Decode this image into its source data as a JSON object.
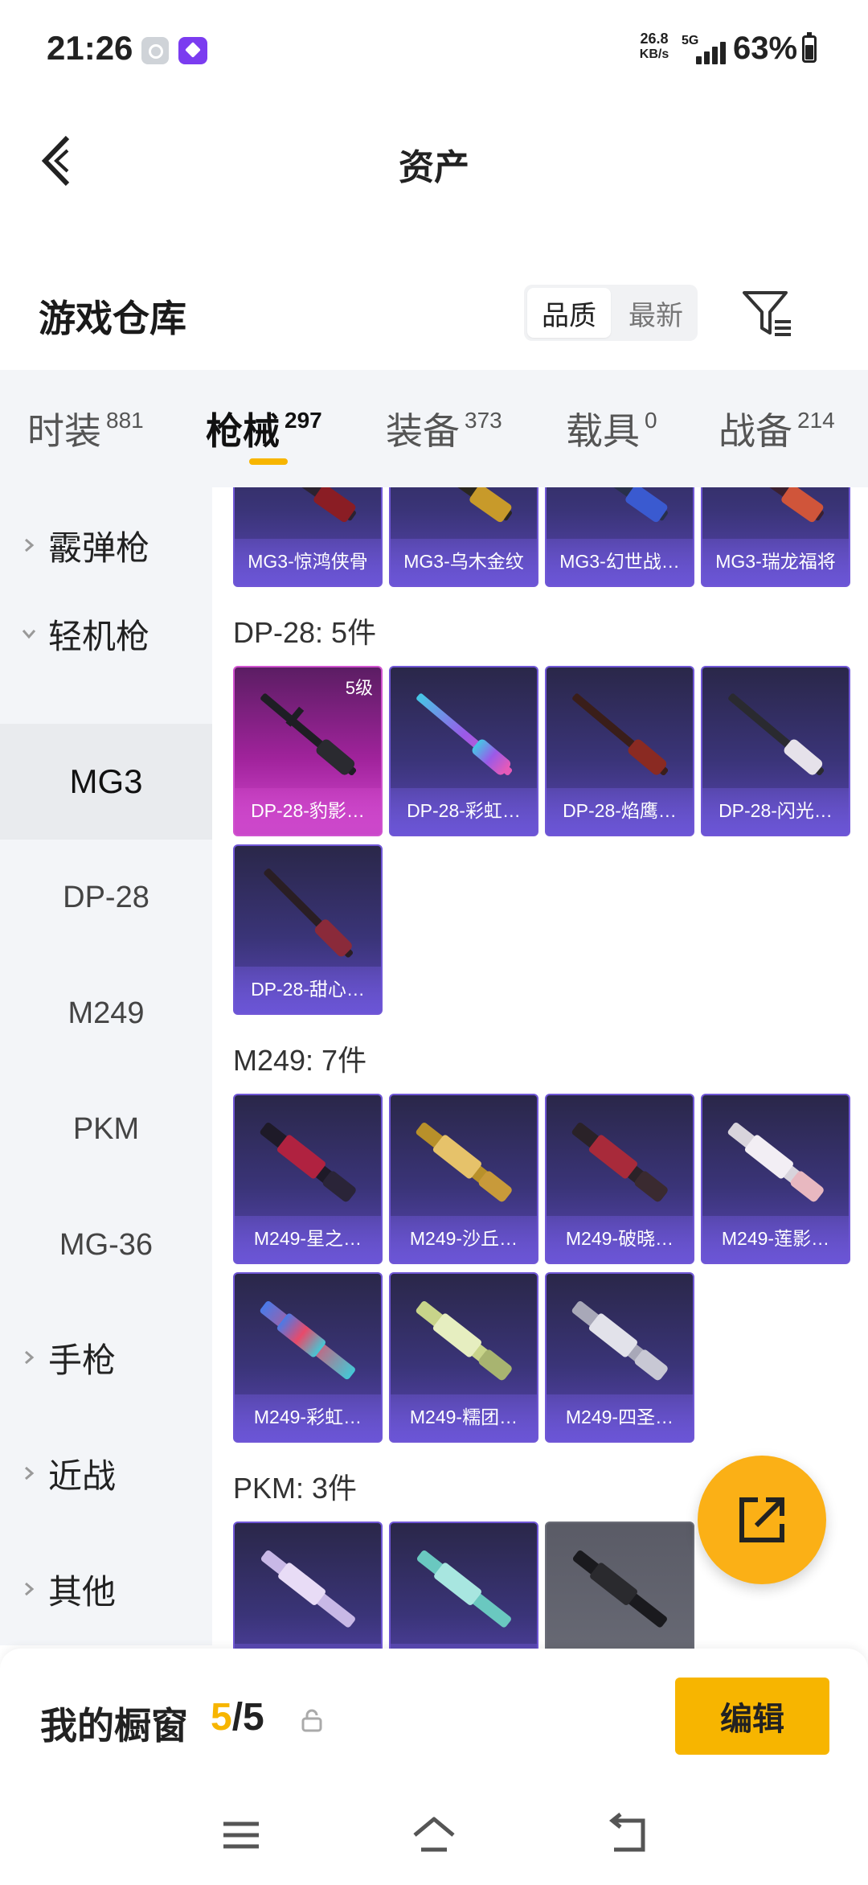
{
  "status_bar": {
    "time": "21:26",
    "net_speed_value": "26.8",
    "net_speed_unit": "KB/s",
    "network_type": "5G",
    "battery_percent": "63%",
    "battery_level": 0.63,
    "status_icons": [
      "settings-app-icon",
      "purple-app-icon"
    ]
  },
  "header": {
    "title": "资产",
    "back_icon": "back-arrow-icon"
  },
  "section": {
    "title": "游戏仓库",
    "sort_options": [
      "品质",
      "最新"
    ],
    "sort_selected": "品质",
    "filter_icon": "filter-icon"
  },
  "tabs": [
    {
      "label": "时装",
      "count": "881"
    },
    {
      "label": "枪械",
      "count": "297",
      "active": true
    },
    {
      "label": "装备",
      "count": "373"
    },
    {
      "label": "载具",
      "count": "0"
    },
    {
      "label": "战备",
      "count": "214"
    }
  ],
  "sidebar": {
    "items": [
      {
        "label": "霰弹枪",
        "type": "group",
        "expanded": false
      },
      {
        "label": "轻机枪",
        "type": "group",
        "expanded": true
      },
      {
        "label": "MG3",
        "type": "sub",
        "selected": true
      },
      {
        "label": "DP-28",
        "type": "sub"
      },
      {
        "label": "M249",
        "type": "sub"
      },
      {
        "label": "PKM",
        "type": "sub"
      },
      {
        "label": "MG-36",
        "type": "sub"
      },
      {
        "label": "手枪",
        "type": "group",
        "expanded": false
      },
      {
        "label": "近战",
        "type": "group",
        "expanded": false
      },
      {
        "label": "其他",
        "type": "group",
        "expanded": false
      }
    ]
  },
  "content": {
    "mg3_items": [
      "MG3-惊鸿侠骨",
      "MG3-乌木金纹",
      "MG3-幻世战…",
      "MG3-瑞龙福将"
    ],
    "dp28_header": "DP-28: 5件",
    "dp28_items": [
      {
        "name": "DP-28-豹影…",
        "level": "5级",
        "style": "pink"
      },
      {
        "name": "DP-28-彩虹…"
      },
      {
        "name": "DP-28-焰鹰…"
      },
      {
        "name": "DP-28-闪光…"
      },
      {
        "name": "DP-28-甜心…"
      }
    ],
    "m249_header": "M249: 7件",
    "m249_items": [
      "M249-星之…",
      "M249-沙丘…",
      "M249-破晓…",
      "M249-莲影…",
      "M249-彩虹…",
      "M249-糯团…",
      "M249-四圣…"
    ],
    "pkm_header": "PKM: 3件",
    "pkm_items": [
      {
        "name": "",
        "style": "purple"
      },
      {
        "name": "",
        "style": "purple"
      },
      {
        "name": "",
        "style": "gray"
      }
    ]
  },
  "fab": {
    "icon": "share-external-icon"
  },
  "bottom": {
    "showcase_label": "我的橱窗",
    "showcase_current": "5",
    "showcase_total": "/5",
    "lock_icon": "lock-icon",
    "edit_label": "编辑"
  },
  "nav": {
    "icons": [
      "menu-icon",
      "home-icon",
      "back-icon"
    ]
  },
  "colors": {
    "accent": "#F7B500",
    "card_purple": "#3A3478",
    "card_pink": "#A1239C",
    "card_gray": "#6B6D78"
  }
}
